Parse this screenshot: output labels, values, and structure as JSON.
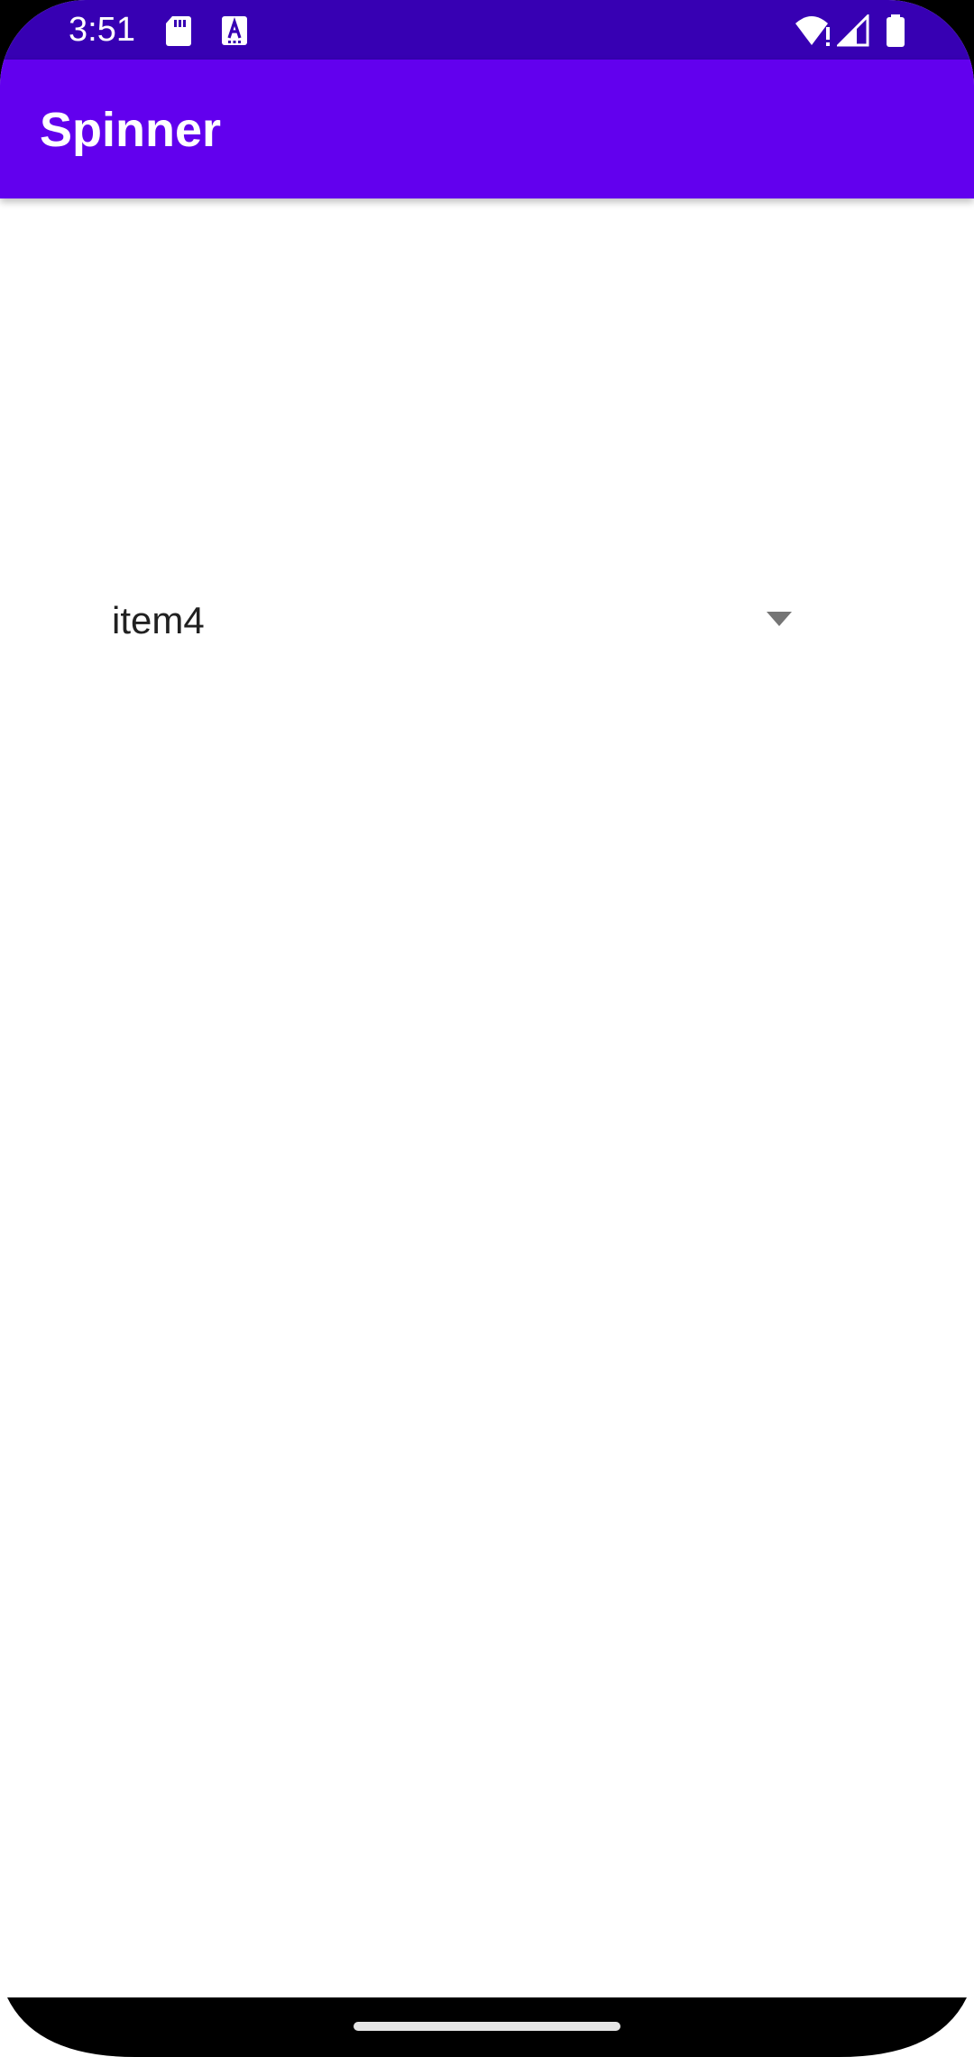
{
  "status_bar": {
    "time": "3:51",
    "icons": [
      "sd-card-icon",
      "text-a-icon",
      "wifi-icon",
      "signal-icon",
      "battery-icon"
    ],
    "background": "#3700b3"
  },
  "app_bar": {
    "title": "Spinner",
    "background": "#6200ee"
  },
  "spinner": {
    "selected_value": "item4",
    "arrow_icon": "dropdown-arrow-icon"
  },
  "navigation": {
    "handle_icon": "home-gesture-handle"
  }
}
